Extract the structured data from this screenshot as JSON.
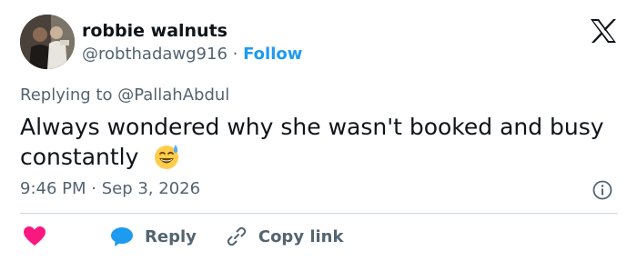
{
  "author": {
    "name": "robbie walnuts",
    "handle": "@robthadawg916",
    "separator": "·",
    "follow_label": "Follow"
  },
  "tweet": {
    "replying_to": "Replying to @PallahAbdul",
    "text": "Always wondered why she wasn't booked and busy constantly",
    "emoji": "sweat-smile-emoji",
    "time": "9:46 PM · Sep 3, 2026"
  },
  "actions": {
    "like_icon": "heart-icon",
    "reply_label": "Reply",
    "copy_link_label": "Copy link"
  },
  "colors": {
    "text": "#0f1419",
    "secondary": "#536471",
    "link": "#1d9bf0",
    "like": "#f91880",
    "divider": "#cfd9de"
  }
}
